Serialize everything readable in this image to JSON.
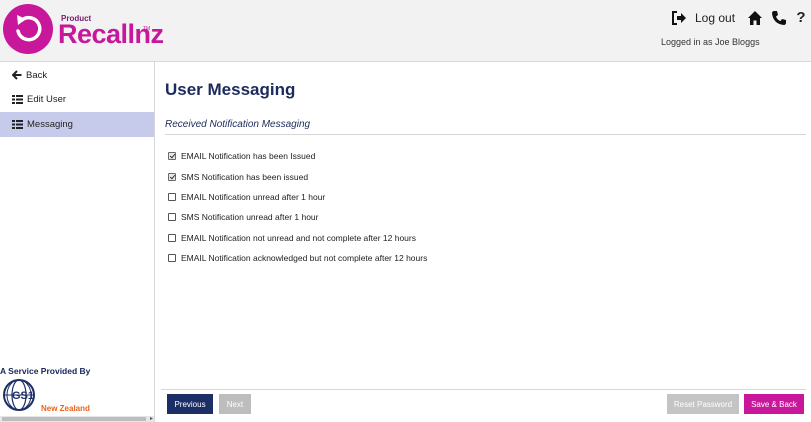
{
  "header": {
    "logo_small": "Product",
    "logo_big": "Recallnz",
    "logo_tm": "TM",
    "logout_label": "Log out",
    "logged_in_text": "Logged in as Joe Bloggs",
    "icons": [
      "logout-icon",
      "home-icon",
      "phone-icon",
      "help-icon"
    ],
    "help_glyph": "?"
  },
  "sidebar": {
    "items": [
      {
        "label": "Back",
        "icon": "arrow-left-icon"
      },
      {
        "label": "Edit User",
        "icon": "list-icon"
      },
      {
        "label": "Messaging",
        "icon": "list-icon",
        "active": true
      }
    ],
    "service_text": "A Service Provided By",
    "gs1_text": "GS1",
    "gs1_nz": "New Zealand"
  },
  "main": {
    "title": "User Messaging",
    "section_title": "Received Notification Messaging",
    "options": [
      {
        "label": "EMAIL Notification has been Issued",
        "checked": true
      },
      {
        "label": "SMS Notification has been issued",
        "checked": true
      },
      {
        "label": "EMAIL Notification unread after 1 hour",
        "checked": false
      },
      {
        "label": "SMS Notification unread after 1 hour",
        "checked": false
      },
      {
        "label": "EMAIL Notification not unread and not complete after 12 hours",
        "checked": false
      },
      {
        "label": "EMAIL Notification acknowledged but not complete after 12 hours",
        "checked": false
      }
    ]
  },
  "footer": {
    "previous": "Previous",
    "next": "Next",
    "reset": "Reset Password",
    "save": "Save & Back"
  },
  "colors": {
    "brand_magenta": "#c8179a",
    "navy": "#1d2b5c",
    "active_item": "#c7cbeb",
    "gs1_orange": "#e8641e"
  }
}
